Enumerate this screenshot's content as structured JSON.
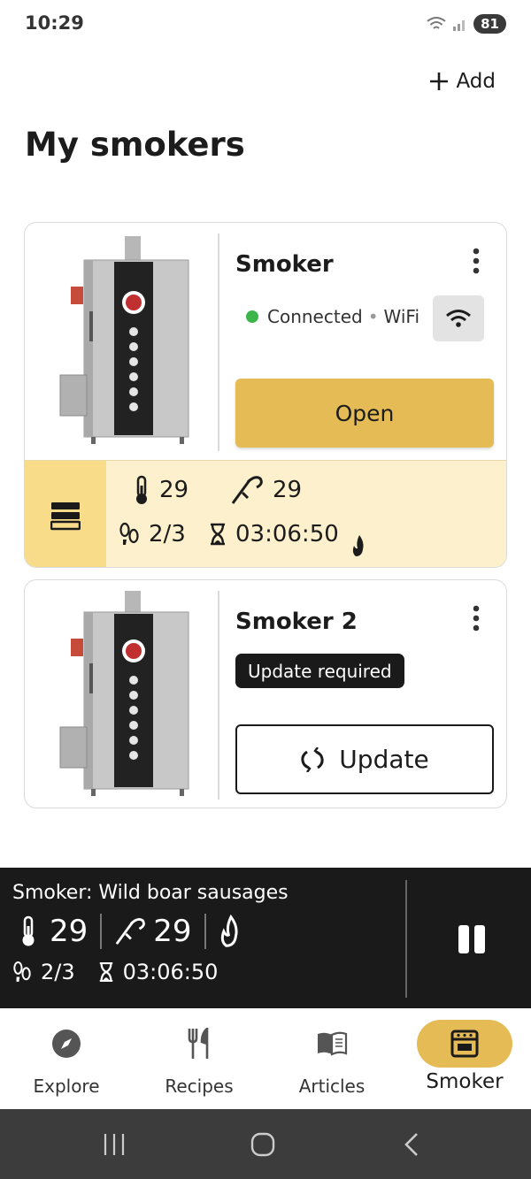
{
  "status": {
    "time": "10:29",
    "battery": "81"
  },
  "header": {
    "add_label": "Add",
    "title": "My smokers"
  },
  "smokers": [
    {
      "name": "Smoker",
      "connection_status": "Connected",
      "connection_type": "WiFi",
      "action_label": "Open",
      "stats": {
        "temperature": "29",
        "probe": "29",
        "stage": "2/3",
        "timer": "03:06:50"
      }
    },
    {
      "name": "Smoker 2",
      "badge": "Update required",
      "action_label": "Update"
    }
  ],
  "player": {
    "title": "Smoker: Wild boar sausages",
    "temperature": "29",
    "probe": "29",
    "stage": "2/3",
    "timer": "03:06:50"
  },
  "nav": {
    "items": [
      {
        "label": "Explore",
        "icon": "compass-icon"
      },
      {
        "label": "Recipes",
        "icon": "cutlery-icon"
      },
      {
        "label": "Articles",
        "icon": "book-icon"
      },
      {
        "label": "Smoker",
        "icon": "smoker-icon"
      }
    ],
    "active": "Smoker"
  },
  "colors": {
    "accent": "#e4bb55",
    "band": "#fdf0cc",
    "band_icon": "#f8dc8a",
    "connected": "#3cb54a",
    "player_bg": "#1a1a1a"
  }
}
